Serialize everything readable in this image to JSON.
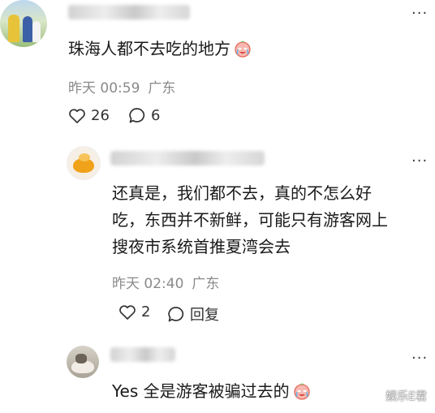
{
  "comment_main": {
    "text": "珠海人都不去吃的地方",
    "time": "昨天 00:59",
    "location": "广东",
    "likes": "26",
    "replies": "6"
  },
  "reply_1": {
    "text_lines": [
      "还真是，我们都不去，真的不怎么好",
      "吃，东西并不新鲜，可能只有游客网上",
      "搜夜市系统首推夏湾会去"
    ],
    "time": "昨天 02:40",
    "location": "广东",
    "likes": "2",
    "reply_label": "回复"
  },
  "reply_2": {
    "text": "Yes 全是游客被骗过去的"
  },
  "more_label": "···",
  "watermark": "娱乐E君",
  "icons": {
    "like": "heart-outline-icon",
    "comment": "speech-bubble-icon",
    "emoji": "crying-laughing-face-icon",
    "more": "more-dots-icon"
  }
}
